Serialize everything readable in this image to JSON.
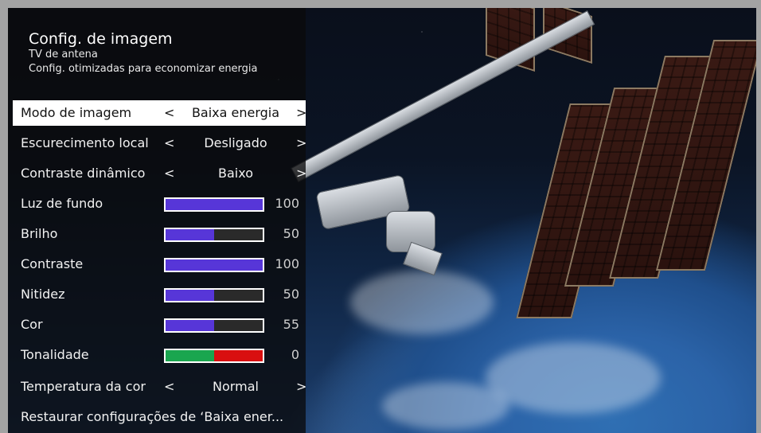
{
  "header": {
    "title": "Config. de imagem",
    "source": "TV de antena",
    "note": "Config. otimizadas para economizar energia"
  },
  "rows": [
    {
      "label": "Modo de imagem",
      "value": "Baixa energia",
      "prev": "<",
      "next": ">"
    },
    {
      "label": "Escurecimento local",
      "value": "Desligado",
      "prev": "<",
      "next": ">"
    },
    {
      "label": "Contraste dinâmico",
      "value": "Baixo",
      "prev": "<",
      "next": ">"
    }
  ],
  "sliders": [
    {
      "label": "Luz de fundo",
      "value": "100",
      "fraction": 1.0
    },
    {
      "label": "Brilho",
      "value": "50",
      "fraction": 0.5
    },
    {
      "label": "Contraste",
      "value": "100",
      "fraction": 1.0
    },
    {
      "label": "Nitidez",
      "value": "50",
      "fraction": 0.5
    },
    {
      "label": "Cor",
      "value": "55",
      "fraction": 0.5
    }
  ],
  "tint": {
    "label": "Tonalidade",
    "value": "0"
  },
  "color_temp": {
    "label": "Temperatura da cor",
    "value": "Normal",
    "prev": "<",
    "next": ">"
  },
  "restore": {
    "label": "Restaurar configurações de ‘Baixa ener..."
  },
  "colors": {
    "slider_fill": "#5736d8",
    "tint_green": "#1aa64f",
    "tint_red": "#d90f10",
    "selected_bg": "#ffffff"
  }
}
